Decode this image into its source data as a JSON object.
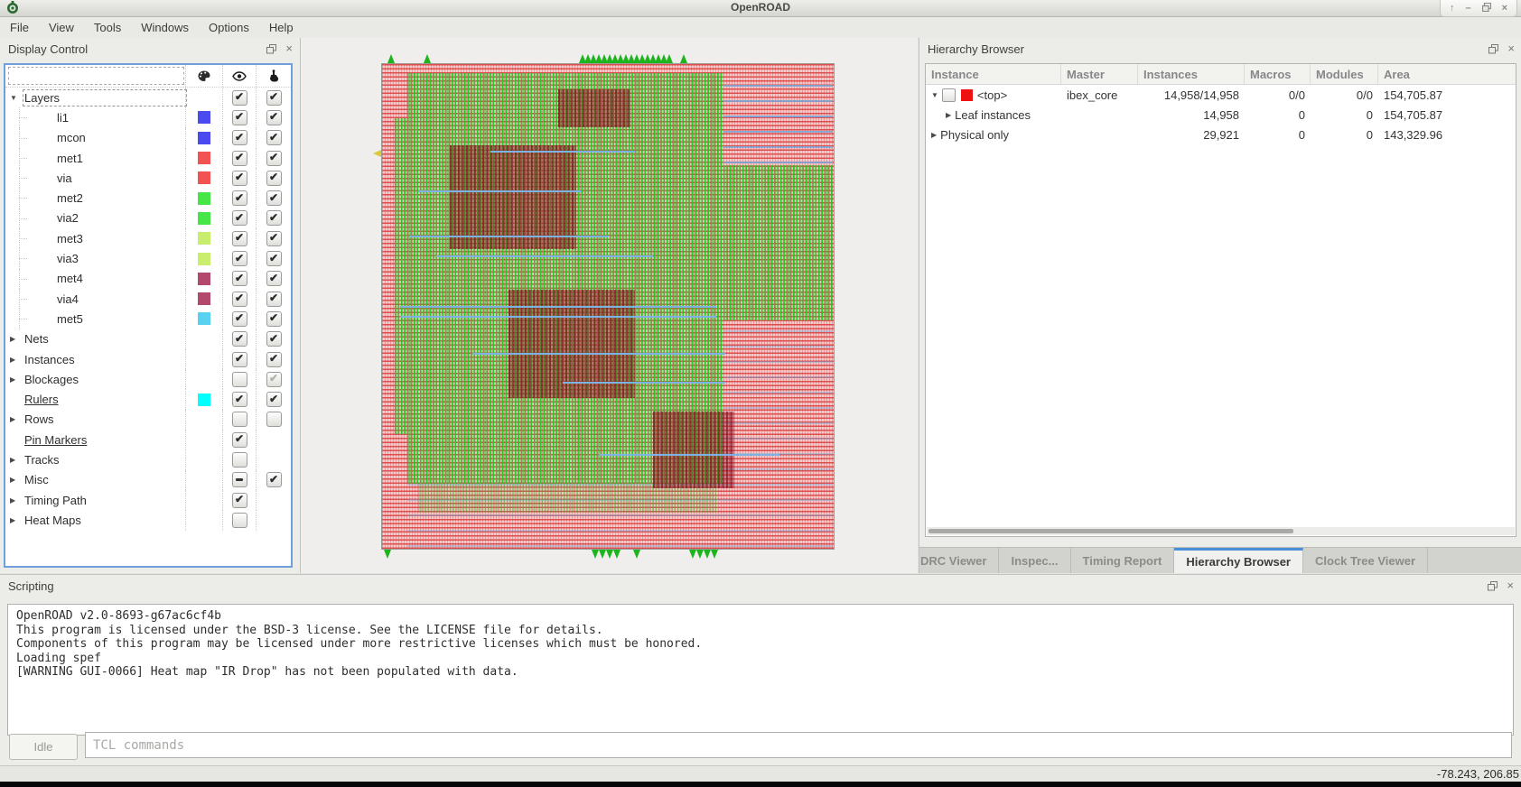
{
  "window": {
    "title": "OpenROAD",
    "controls": {
      "shade": "↑",
      "minimize": "–",
      "maximize": "restore",
      "close": "×"
    }
  },
  "menu": {
    "items": [
      "File",
      "View",
      "Tools",
      "Windows",
      "Options",
      "Help"
    ]
  },
  "display_control": {
    "title": "Display Control",
    "columns": [
      "palette",
      "visibility",
      "selectable"
    ],
    "tree": [
      {
        "label": "Layers",
        "kind": "group",
        "arrow": "▼",
        "eye": "on",
        "sel": "on",
        "focus": true
      },
      {
        "label": "li1",
        "kind": "layer",
        "child": true,
        "swatch": "#4a4aee",
        "eye": "on",
        "sel": "on"
      },
      {
        "label": "mcon",
        "kind": "layer",
        "child": true,
        "swatch": "#4a4aee",
        "eye": "on",
        "sel": "on"
      },
      {
        "label": "met1",
        "kind": "layer",
        "child": true,
        "swatch": "#f25252",
        "eye": "on",
        "sel": "on"
      },
      {
        "label": "via",
        "kind": "layer",
        "child": true,
        "swatch": "#f25252",
        "eye": "on",
        "sel": "on"
      },
      {
        "label": "met2",
        "kind": "layer",
        "child": true,
        "swatch": "#46e646",
        "eye": "on",
        "sel": "on"
      },
      {
        "label": "via2",
        "kind": "layer",
        "child": true,
        "swatch": "#46e646",
        "eye": "on",
        "sel": "on"
      },
      {
        "label": "met3",
        "kind": "layer",
        "child": true,
        "swatch": "#c9ee6e",
        "eye": "on",
        "sel": "on"
      },
      {
        "label": "via3",
        "kind": "layer",
        "child": true,
        "swatch": "#c9ee6e",
        "eye": "on",
        "sel": "on"
      },
      {
        "label": "met4",
        "kind": "layer",
        "child": true,
        "swatch": "#b2486c",
        "eye": "on",
        "sel": "on"
      },
      {
        "label": "via4",
        "kind": "layer",
        "child": true,
        "swatch": "#b2486c",
        "eye": "on",
        "sel": "on"
      },
      {
        "label": "met5",
        "kind": "layer",
        "child": true,
        "swatch": "#59d2f2",
        "eye": "on",
        "sel": "on"
      },
      {
        "label": "Nets",
        "kind": "group",
        "arrow": "▶",
        "eye": "on",
        "sel": "on"
      },
      {
        "label": "Instances",
        "kind": "group",
        "arrow": "▶",
        "eye": "on",
        "sel": "on"
      },
      {
        "label": "Blockages",
        "kind": "group",
        "arrow": "▶",
        "eye": "off",
        "sel": "disabled"
      },
      {
        "label": "Rulers",
        "kind": "leaf",
        "underline": true,
        "swatch": "#00ffff",
        "eye": "on",
        "sel": "on"
      },
      {
        "label": "Rows",
        "kind": "group",
        "arrow": "▶",
        "eye": "off",
        "sel": "off"
      },
      {
        "label": "Pin Markers",
        "kind": "leaf",
        "underline": true,
        "eye": "on",
        "sel": "none"
      },
      {
        "label": "Tracks",
        "kind": "group",
        "arrow": "▶",
        "eye": "off",
        "sel": "none"
      },
      {
        "label": "Misc",
        "kind": "group",
        "arrow": "▶",
        "eye": "partial",
        "sel": "on"
      },
      {
        "label": "Timing Path",
        "kind": "group",
        "arrow": "▶",
        "eye": "on",
        "sel": "none"
      },
      {
        "label": "Heat Maps",
        "kind": "group",
        "arrow": "▶",
        "eye": "off",
        "sel": "none"
      }
    ]
  },
  "hierarchy_browser": {
    "title": "Hierarchy Browser",
    "columns": [
      "Instance",
      "Master",
      "Instances",
      "Macros",
      "Modules",
      "Area"
    ],
    "rows": [
      {
        "instance": "<top>",
        "master": "ibex_core",
        "instances": "14,958/14,958",
        "macros": "0/0",
        "modules": "0/0",
        "area": "154,705.87",
        "arrow": "▼",
        "checkbox": true,
        "swatch": "#ee1111",
        "indent": 0
      },
      {
        "instance": "Leaf instances",
        "master": "",
        "instances": "14,958",
        "macros": "0",
        "modules": "0",
        "area": "154,705.87",
        "arrow": "▶",
        "indent": 1
      },
      {
        "instance": "Physical only",
        "master": "",
        "instances": "29,921",
        "macros": "0",
        "modules": "0",
        "area": "143,329.96",
        "arrow": "▶",
        "indent": 0
      }
    ]
  },
  "dock_tabs": {
    "items": [
      {
        "label": "DRC Viewer",
        "active": false
      },
      {
        "label": "Inspec...",
        "active": false
      },
      {
        "label": "Timing Report",
        "active": false
      },
      {
        "label": "Hierarchy Browser",
        "active": true
      },
      {
        "label": "Clock Tree Viewer",
        "active": false
      }
    ]
  },
  "scripting": {
    "title": "Scripting",
    "lines": [
      "OpenROAD v2.0-8693-g67ac6cf4b",
      "This program is licensed under the BSD-3 license. See the LICENSE file for details.",
      "Components of this program may be licensed under more restrictive licenses which must be honored.",
      "Loading spef",
      "[WARNING GUI-0066] Heat map \"IR Drop\" has not been populated with data."
    ],
    "status_button": "Idle",
    "input_placeholder": "TCL commands"
  },
  "status_bar": {
    "coordinates": "-78.243, 206.85"
  },
  "colors": {
    "accent_tab": "#4a90d9",
    "tree_focus_border": "#6f9fd8",
    "die_green": "#22c822",
    "die_red": "#d53030",
    "pin_green": "#1db41d"
  }
}
